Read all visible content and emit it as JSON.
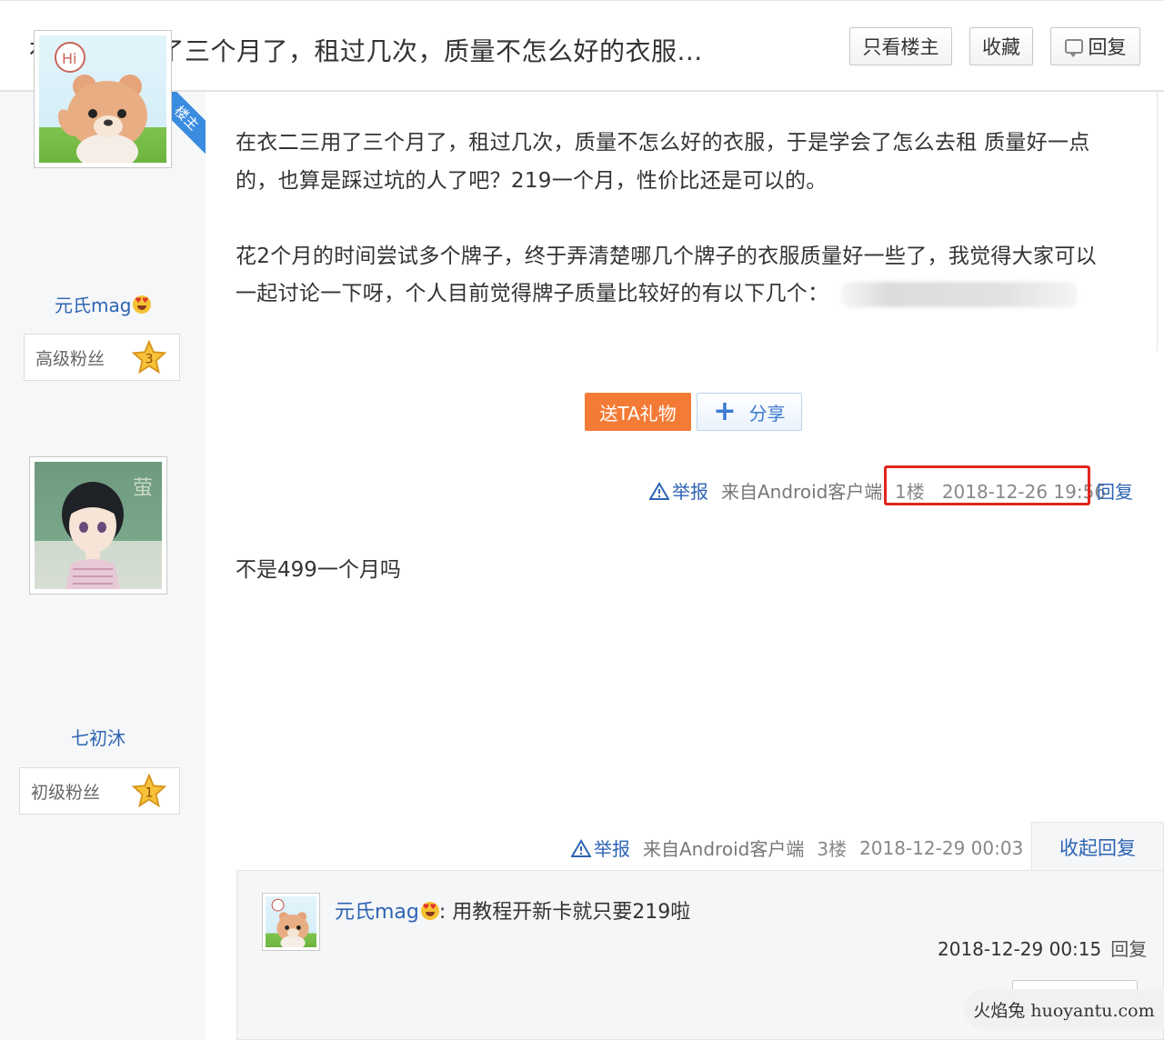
{
  "header": {
    "title": "在衣二三用了三个月了，租过几次，质量不怎么好的衣服...",
    "only_op_label": "只看楼主",
    "favorite_label": "收藏",
    "reply_label": "回复"
  },
  "post1": {
    "op_badge": "楼主",
    "username": "元氏mag",
    "fan_level_label": "高级粉丝",
    "fan_level": "3",
    "lines": [
      "在衣二三用了三个月了，租过几次，质量不怎么好的衣服，于是学会了怎么去租 质量好一点",
      "的，也算是踩过坑的人了吧？219一个月，性价比还是可以的。",
      "花2个月的时间尝试多个牌子，终于弄清楚哪几个牌子的衣服质量好一些了，我觉得大家可以",
      "一起讨论一下呀，个人目前觉得牌子质量比较好的有以下几个："
    ],
    "gift_label": "送TA礼物",
    "share_label": "分享",
    "report_label": "举报",
    "from_label": "来自Android客户端",
    "floor": "1楼",
    "time": "2018-12-26 19:56",
    "reply_label": "回复"
  },
  "post2": {
    "username": "七初沐",
    "fan_level_label": "初级粉丝",
    "fan_level": "1",
    "text": "不是499一个月吗",
    "report_label": "举报",
    "from_label": "来自Android客户端",
    "floor": "3楼",
    "time": "2018-12-29 00:03",
    "collapse_label": "收起回复",
    "subreply": {
      "username": "元氏mag",
      "text": ": 用教程开新卡就只要219啦",
      "time": "2018-12-29 00:15",
      "reply_label": "回复"
    }
  },
  "watermark": "火焰兔 huoyantu.com",
  "colors": {
    "link": "#2d64b3",
    "gift": "#f47b36",
    "highlight": "#e1251b",
    "op_badge": "#3a8ce0"
  }
}
